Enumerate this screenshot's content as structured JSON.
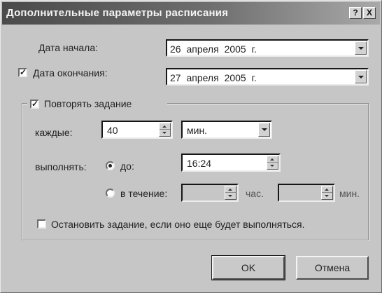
{
  "window": {
    "title": "Дополнительные параметры расписания",
    "help_label": "?",
    "close_label": "X"
  },
  "start_date": {
    "label": "Дата начала:",
    "value": "26 апреля 2005 г."
  },
  "end_date": {
    "label": "Дата окончания:",
    "value": "27 апреля 2005 г.",
    "checked": true,
    "check_glyph": "✓"
  },
  "repeat": {
    "label": "Повторять задание",
    "checked": true,
    "check_glyph": "✓",
    "every_label": "каждые:",
    "every_value": "40",
    "unit_value": "мин.",
    "run_label": "выполнять:",
    "until_label": "до:",
    "until_value": "16:24",
    "duration_label": "в течение:",
    "hours_value": "",
    "hours_label": "час.",
    "minutes_value": "",
    "minutes_label": "мин."
  },
  "stop_task": {
    "label": "Остановить задание, если оно еще будет выполняться.",
    "checked": false
  },
  "buttons": {
    "ok": "OK",
    "cancel": "Отмена"
  }
}
